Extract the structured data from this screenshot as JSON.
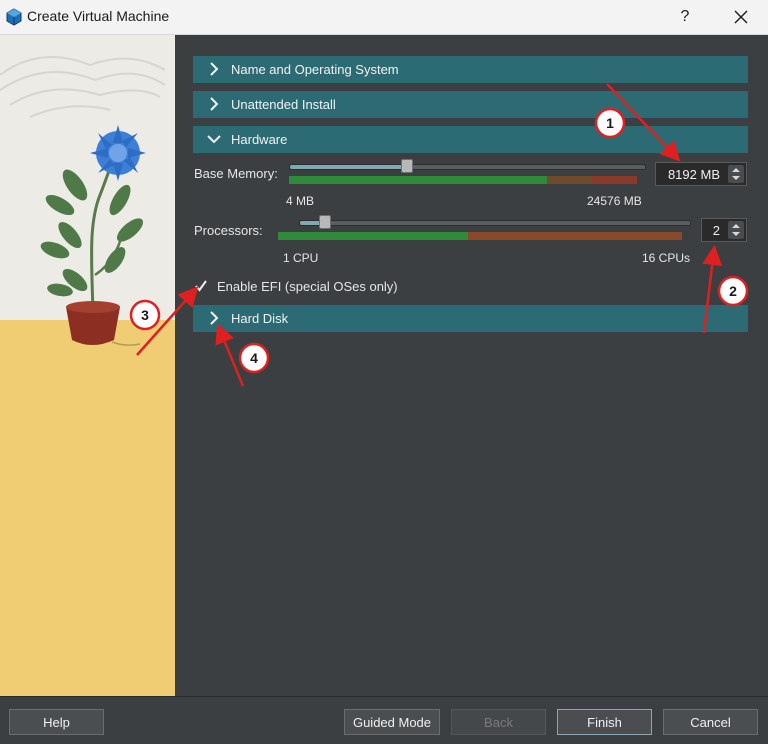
{
  "window": {
    "title": "Create Virtual Machine",
    "help_glyph": "?"
  },
  "sections": {
    "name_os": {
      "label": "Name and Operating System"
    },
    "unattended": {
      "label": "Unattended Install"
    },
    "hardware": {
      "label": "Hardware"
    },
    "hard_disk": {
      "label": "Hard Disk"
    }
  },
  "hardware": {
    "base_memory": {
      "label": "Base Memory:",
      "value": "8192 MB",
      "min_label": "4 MB",
      "max_label": "24576 MB",
      "value_mb": 8192,
      "min_mb": 4,
      "max_mb": 24576
    },
    "processors": {
      "label": "Processors:",
      "value": "2",
      "min_label": "1 CPU",
      "max_label": "16 CPUs",
      "value_count": 2,
      "min_count": 1,
      "max_count": 16
    },
    "efi": {
      "label": "Enable EFI (special OSes only)",
      "checked": true
    }
  },
  "annotations": [
    "1",
    "2",
    "3",
    "4"
  ],
  "footer": {
    "help": "Help",
    "guided_mode": "Guided Mode",
    "back": "Back",
    "finish": "Finish",
    "cancel": "Cancel"
  },
  "colors": {
    "section_header": "#2c6b74",
    "panel_bg": "#3c3f41",
    "annotation_red": "#e02020",
    "zone_green": "#2f8a3a",
    "zone_red": "#8a3a2a"
  }
}
